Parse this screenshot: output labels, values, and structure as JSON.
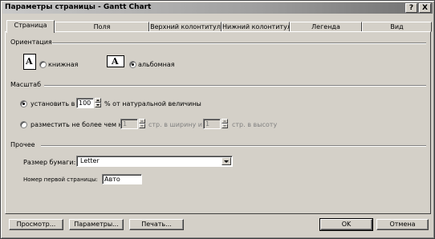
{
  "window": {
    "title": "Параметры страницы - Gantt Chart",
    "help_label": "?",
    "close_label": "X"
  },
  "tabs": [
    {
      "label": "Страница",
      "active": true
    },
    {
      "label": "Поля",
      "active": false
    },
    {
      "label": "Верхний колонтитул",
      "active": false
    },
    {
      "label": "Нижний колонтитул",
      "active": false
    },
    {
      "label": "Легенда",
      "active": false
    },
    {
      "label": "Вид",
      "active": false
    }
  ],
  "orientation": {
    "group_label": "Ориентация",
    "portrait_label": "книжная",
    "landscape_label": "альбомная",
    "selected": "landscape",
    "icon_letter": "A"
  },
  "scale": {
    "group_label": "Масштаб",
    "adjust_label": "установить в",
    "adjust_value": "100",
    "adjust_suffix": "% от натуральной величины",
    "fit_label": "разместить не более чем на",
    "fit_wide_value": "1",
    "fit_wide_suffix": "стр. в ширину и",
    "fit_tall_value": "1",
    "fit_tall_suffix": "стр. в высоту",
    "selected": "adjust"
  },
  "other": {
    "group_label": "Прочее",
    "paper_size_label": "Размер бумаги:",
    "paper_size_value": "Letter",
    "first_page_label": "Номер первой страницы:",
    "first_page_value": "Авто"
  },
  "buttons": {
    "preview": "Просмотр...",
    "options": "Параметры...",
    "print": "Печать...",
    "ok": "OK",
    "cancel": "Отмена"
  }
}
